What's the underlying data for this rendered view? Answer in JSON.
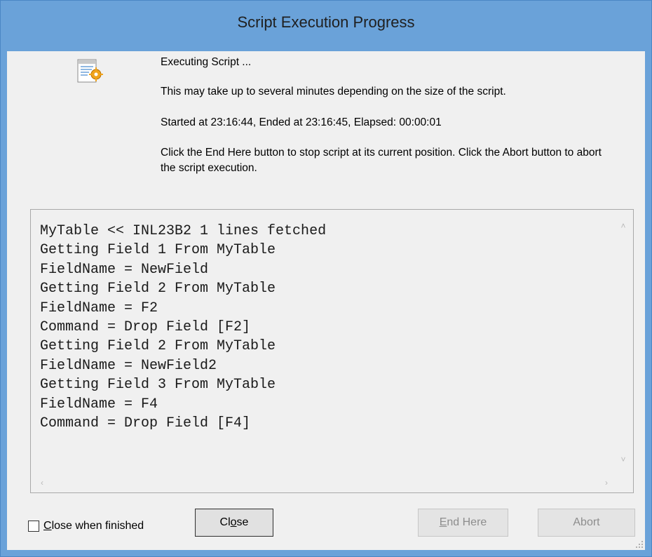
{
  "window": {
    "title": "Script Execution Progress"
  },
  "info": {
    "status": "Executing Script ...",
    "notice": "This may take up to several minutes depending on the size of the script.",
    "timing": "Started at 23:16:44, Ended at 23:16:45,  Elapsed: 00:00:01",
    "help": "Click the End Here button to stop script at its current position. Click the Abort button to abort the script execution."
  },
  "log": {
    "lines": [
      "MyTable << INL23B2 1 lines fetched",
      "Getting Field 1 From MyTable",
      "FieldName = NewField",
      "Getting Field 2 From MyTable",
      "FieldName = F2",
      "Command = Drop Field [F2]",
      "Getting Field 2 From MyTable",
      "FieldName = NewField2",
      "Getting Field 3 From MyTable",
      "FieldName = F4",
      "Command = Drop Field [F4]"
    ]
  },
  "footer": {
    "checkbox_label_first": "C",
    "checkbox_label_rest": "lose when finished",
    "checkbox_checked": false,
    "close_label_a": "Cl",
    "close_label_u": "o",
    "close_label_b": "se",
    "endhere_label_u": "E",
    "endhere_label_rest": "nd Here",
    "abort_label": "Abort"
  },
  "icons": {
    "script": "script-gear-icon",
    "scroll_up": "chevron-up-icon",
    "scroll_down": "chevron-down-icon",
    "scroll_left": "chevron-left-icon",
    "scroll_right": "chevron-right-icon",
    "resize": "resize-grip-icon"
  },
  "colors": {
    "titlebar": "#6aa2d9",
    "client": "#f0f0f0"
  }
}
